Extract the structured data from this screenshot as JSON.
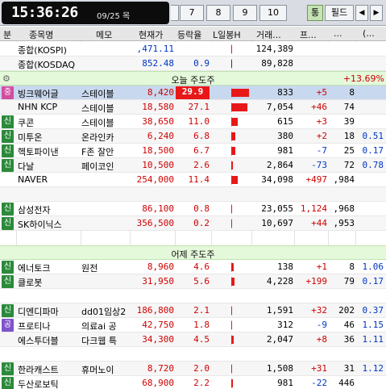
{
  "clock": {
    "time": "15:36:26",
    "date": "09/25 목"
  },
  "toolbar": {
    "number_buttons": [
      "7",
      "8",
      "9",
      "10"
    ],
    "toggle_label": "통",
    "field_label": "필드",
    "prev_icon": "◀",
    "next_icon": "▶"
  },
  "header": {
    "col_category": "분",
    "col_name": "종목명",
    "col_memo": "메모",
    "col_price": "현재가",
    "col_rate": "등락율",
    "col_bar": "L일봉H",
    "col_volume": "거래...",
    "col_net": "프...",
    "col_v1": "...",
    "col_v2": "(..."
  },
  "index_rows": [
    {
      "name": "종합(KOSPI)",
      "price": ",471.11",
      "rate": "",
      "volume": "124,389"
    },
    {
      "name": "종합(KOSDAQ",
      "price": "852.48",
      "rate": "0.9",
      "volume": "89,828"
    }
  ],
  "section_today": {
    "title": "오늘 주도주",
    "rate": "+13.69%"
  },
  "today_rows": [
    {
      "tag": "중",
      "name": "빙크웨어글",
      "memo": "스테이블",
      "price": "8,420",
      "rate": "29.9",
      "bar": 0.95,
      "volume": "833",
      "net": "+5",
      "v1": "8",
      "v2": ""
    },
    {
      "tag": "",
      "name": "NHN KCP",
      "memo": "스테이블",
      "price": "18,580",
      "rate": "27.1",
      "bar": 0.85,
      "volume": "7,054",
      "net": "+46",
      "v1": "74",
      "v2": ""
    },
    {
      "tag": "신",
      "name": "쿠콘",
      "memo": "스테이블",
      "price": "38,650",
      "rate": "11.0",
      "bar": 0.35,
      "volume": "615",
      "net": "+3",
      "v1": "39",
      "v2": ""
    },
    {
      "tag": "신",
      "name": "미투온",
      "memo": "온라인카",
      "price": "6,240",
      "rate": "6.8",
      "bar": 0.22,
      "volume": "380",
      "net": "+2",
      "v1": "18",
      "v2": "0.51"
    },
    {
      "tag": "신",
      "name": "헥토파이낸",
      "memo": "F존 잘안",
      "price": "18,500",
      "rate": "6.7",
      "bar": 0.21,
      "volume": "981",
      "net": "-7",
      "v1": "25",
      "v2": "0.17"
    },
    {
      "tag": "신",
      "name": "다날",
      "memo": "페이코인",
      "price": "10,500",
      "rate": "2.6",
      "bar": 0.08,
      "volume": "2,864",
      "net": "-73",
      "v1": "72",
      "v2": "0.78"
    },
    {
      "tag": "",
      "name": "NAVER",
      "memo": "",
      "price": "254,000",
      "rate": "11.4",
      "bar": 0.36,
      "volume": "34,098",
      "net": "+497",
      "v1": ",984",
      "v2": ""
    },
    {
      "tag": "",
      "name": "",
      "memo": "",
      "price": "",
      "rate": "",
      "bar": 0,
      "volume": "",
      "net": "",
      "v1": "",
      "v2": ""
    },
    {
      "tag": "신",
      "name": "삼성전자",
      "memo": "",
      "price": "86,100",
      "rate": "0.8",
      "bar": 0.03,
      "volume": "23,055",
      "net": "1,124",
      "v1": ",968",
      "v2": ""
    },
    {
      "tag": "신",
      "name": "SK하이닉스",
      "memo": "",
      "price": "356,500",
      "rate": "0.2",
      "bar": 0.01,
      "volume": "10,697",
      "net": "+44",
      "v1": ",953",
      "v2": ""
    }
  ],
  "section_yesterday": {
    "title": "어제 주도주"
  },
  "yesterday_rows": [
    {
      "tag": "신",
      "name": "에너토크",
      "memo": "원전",
      "price": "8,960",
      "rate": "4.6",
      "bar": 0.15,
      "volume": "138",
      "net": "+1",
      "v1": "8",
      "v2": "1.06"
    },
    {
      "tag": "신",
      "name": "클로봇",
      "memo": "",
      "price": "31,950",
      "rate": "5.6",
      "bar": 0.18,
      "volume": "4,228",
      "net": "+199",
      "v1": "79",
      "v2": "0.17"
    },
    {
      "tag": "",
      "name": "",
      "memo": "",
      "price": "",
      "rate": "",
      "bar": 0,
      "volume": "",
      "net": "",
      "v1": "",
      "v2": ""
    },
    {
      "tag": "신",
      "name": "디엔디파마",
      "memo": "dd01임상2",
      "price": "186,800",
      "rate": "2.1",
      "bar": 0.06,
      "volume": "1,591",
      "net": "+32",
      "v1": "202",
      "v2": "0.37"
    },
    {
      "tag": "공",
      "name": "프로티나",
      "memo": "의료ai 공",
      "price": "42,750",
      "rate": "1.8",
      "bar": 0.05,
      "volume": "312",
      "net": "-9",
      "v1": "46",
      "v2": "1.15"
    },
    {
      "tag": "",
      "name": "에스투더블",
      "memo": "다크웹 특",
      "price": "34,300",
      "rate": "4.5",
      "bar": 0.14,
      "volume": "2,047",
      "net": "+8",
      "v1": "36",
      "v2": "1.11"
    },
    {
      "tag": "",
      "name": "",
      "memo": "",
      "price": "",
      "rate": "",
      "bar": 0,
      "volume": "",
      "net": "",
      "v1": "",
      "v2": ""
    },
    {
      "tag": "신",
      "name": "한라캐스트",
      "memo": "휴머노이",
      "price": "8,720",
      "rate": "2.0",
      "bar": 0.06,
      "volume": "1,508",
      "net": "+31",
      "v1": "31",
      "v2": "1.12"
    },
    {
      "tag": "신",
      "name": "두산로보틱",
      "memo": "",
      "price": "68,900",
      "rate": "2.2",
      "bar": 0.07,
      "volume": "981",
      "net": "-22",
      "v1": "446",
      "v2": ""
    }
  ],
  "colors": {
    "up": "#d00000",
    "down": "#0036c0",
    "section_bg": "#e4f8da",
    "selected_bg": "#c8d8ee",
    "tag_new": "#2b8a3a",
    "tag_hot": "#d24da0",
    "tag_gong": "#7e54c9"
  }
}
